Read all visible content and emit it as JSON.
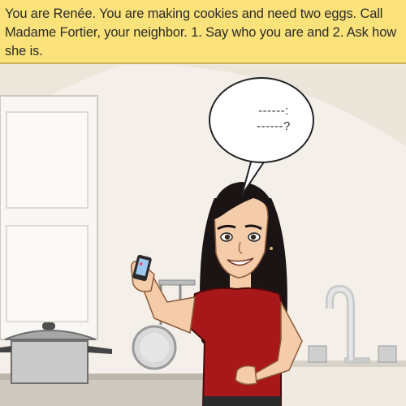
{
  "prompt": {
    "text": "You are Renée. You are making cookies and need two eggs. Call Madame Fortier, your neighbor. 1. Say who you are and 2. Ask how she is."
  },
  "speech_bubble": {
    "line1": "------:",
    "line2": "------?"
  },
  "colors": {
    "banner": "#fbe27a",
    "wall": "#f3eee6",
    "shirt": "#a8181b",
    "hair": "#1b1414"
  }
}
